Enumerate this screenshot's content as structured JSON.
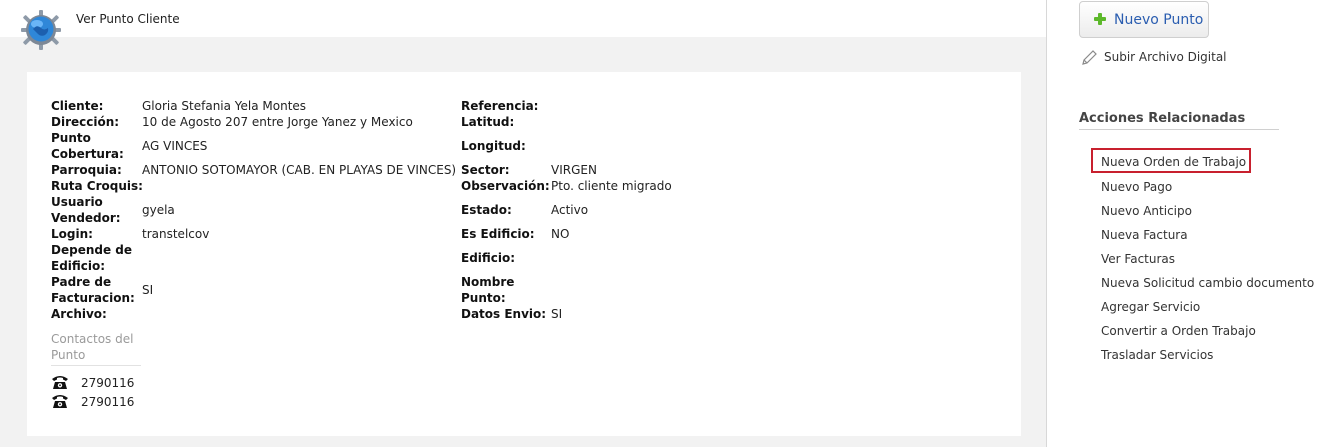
{
  "header": {
    "title": "Ver Punto Cliente",
    "icon": "globe-gear-icon"
  },
  "details_left": {
    "cliente": {
      "label": "Cliente:",
      "value": "Gloria Stefania Yela Montes"
    },
    "direccion": {
      "label": "Dirección:",
      "value": "10 de Agosto 207 entre Jorge Yanez y Mexico"
    },
    "punto_cobertura": {
      "label_1": "Punto",
      "label_2": "Cobertura:",
      "value": "AG VINCES"
    },
    "parroquia": {
      "label": "Parroquia:",
      "value": "ANTONIO SOTOMAYOR (CAB. EN PLAYAS DE VINCES)"
    },
    "ruta_croquis": {
      "label": "Ruta Croquis:",
      "value": ""
    },
    "usuario_vendedor": {
      "label_1": "Usuario",
      "label_2": "Vendedor:",
      "value": "gyela"
    },
    "login": {
      "label": "Login:",
      "value": "transtelcov"
    },
    "depende_edificio": {
      "label_1": "Depende de",
      "label_2": "Edificio:",
      "value": ""
    },
    "padre_facturacion": {
      "label_1": "Padre de",
      "label_2": "Facturacion:",
      "value": "SI"
    },
    "archivo": {
      "label": "Archivo:",
      "value": ""
    }
  },
  "details_right": {
    "referencia": {
      "label": "Referencia:",
      "value": ""
    },
    "latitud": {
      "label": "Latitud:",
      "value": ""
    },
    "longitud": {
      "label": "Longitud:",
      "value": ""
    },
    "sector": {
      "label": "Sector:",
      "value": "VIRGEN"
    },
    "observacion": {
      "label": "Observación:",
      "value": "Pto. cliente migrado"
    },
    "estado": {
      "label": "Estado:",
      "value": "Activo"
    },
    "es_edificio": {
      "label": "Es Edificio:",
      "value": "NO"
    },
    "edificio": {
      "label": "Edificio:",
      "value": ""
    },
    "nombre_punto": {
      "label_1": "Nombre",
      "label_2": "Punto:",
      "value": ""
    },
    "datos_envio": {
      "label": "Datos Envio:",
      "value": "SI"
    }
  },
  "contacts": {
    "title": "Contactos del Punto",
    "phones": [
      {
        "icon": "telephone-icon",
        "number": "2790116"
      },
      {
        "icon": "telephone-icon",
        "number": "2790116"
      }
    ]
  },
  "sidebar": {
    "new_point_button": {
      "label": "Nuevo Punto",
      "icon": "plus-icon",
      "icon_color": "#5cb82a"
    },
    "upload": {
      "label": "Subir Archivo Digital",
      "icon": "pencil-icon"
    },
    "related_title": "Acciones Relacionadas",
    "actions": [
      "Nueva Orden de Trabajo",
      "Nuevo Pago",
      "Nuevo Anticipo",
      "Nueva Factura",
      "Ver Facturas",
      "Nueva Solicitud cambio documento",
      "Agregar Servicio",
      "Convertir a Orden Trabajo",
      "Trasladar Servicios"
    ],
    "highlighted_action": "Nueva Orden de Trabajo",
    "highlight_color": "#c8202e"
  }
}
